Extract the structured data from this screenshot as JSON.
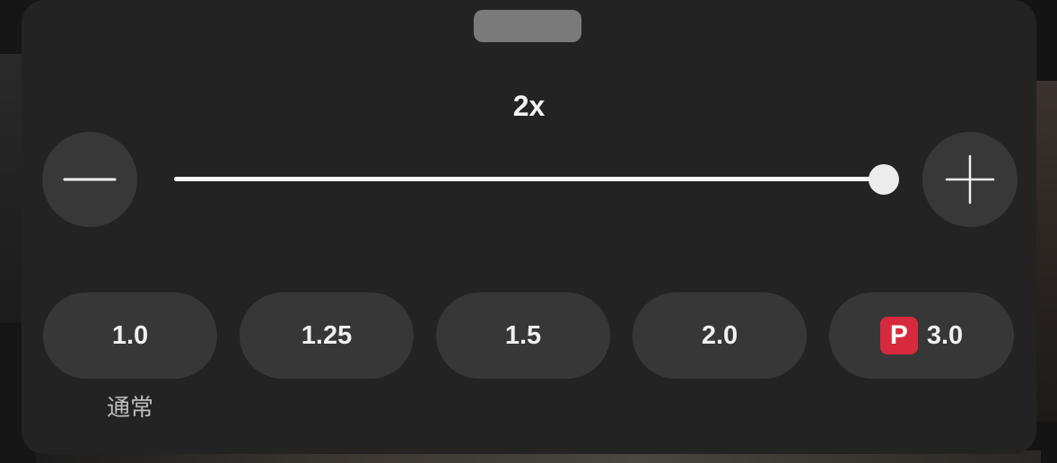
{
  "speed": {
    "current_label": "2x",
    "slider_level_fraction": 1.0
  },
  "controls": {
    "decrease_icon": "minus-icon",
    "increase_icon": "plus-icon"
  },
  "presets": [
    {
      "label": "1.0",
      "caption": "通常"
    },
    {
      "label": "1.25"
    },
    {
      "label": "1.5"
    },
    {
      "label": "2.0"
    },
    {
      "label": "3.0",
      "badge": "P",
      "badge_color": "#d82a3e"
    }
  ],
  "colors": {
    "sheet": "#232323",
    "button": "#373737",
    "accent_premium": "#d82a3e"
  }
}
